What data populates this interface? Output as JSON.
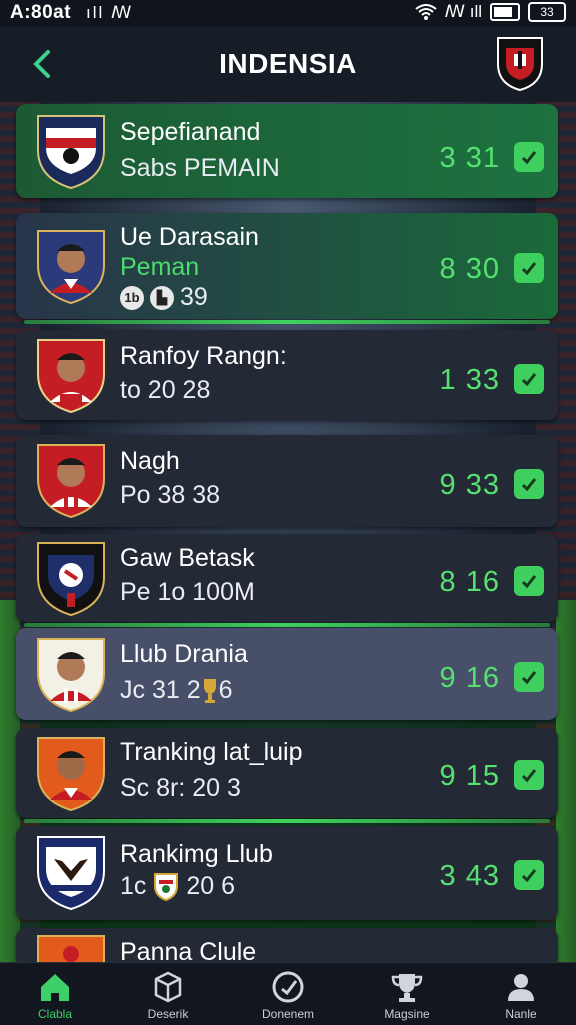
{
  "status": {
    "carrier": "A:80at",
    "left_icons": "ıll ꟿ",
    "right_icons": "ꟿ ıll",
    "battery_label": "33"
  },
  "header": {
    "title": "INDENSIA",
    "back_icon": "chevron-left-icon",
    "crest_icon": "club-crest-icon"
  },
  "accent_color": "#3fcf5f",
  "rows": [
    {
      "name": "Sepefianand",
      "sub": "Sabs PEMAIN",
      "score": "3 31"
    },
    {
      "name": "Ue Darasain",
      "sub": "Peman",
      "extra": "39",
      "score": "8 30"
    },
    {
      "name": "Ranfoy Rangn:",
      "sub": "to 20 28",
      "score": "1 33"
    },
    {
      "name": "Nagh",
      "sub": "Po 38 38",
      "score": "9 33"
    },
    {
      "name": "Gaw Betask",
      "sub": "Pe 1o 100M",
      "score": "8 16"
    },
    {
      "name": "Llub Drania",
      "sub": "Jc 31 2",
      "sub_end": "6",
      "score": "9 16"
    },
    {
      "name": "Tranking lat_luip",
      "sub": "Sc 8r: 20 3",
      "score": "9 15"
    },
    {
      "name": "Rankimg Llub",
      "sub": "1c",
      "sub_end": "20 6",
      "score": "3 43"
    },
    {
      "name": "Panna Clule"
    }
  ],
  "nav": [
    {
      "label": "Clabla",
      "icon": "home-icon"
    },
    {
      "label": "Deserik",
      "icon": "box-icon"
    },
    {
      "label": "Donenem",
      "icon": "target-icon"
    },
    {
      "label": "Magsine",
      "icon": "trophy-icon"
    },
    {
      "label": "Nanle",
      "icon": "user-icon"
    }
  ]
}
